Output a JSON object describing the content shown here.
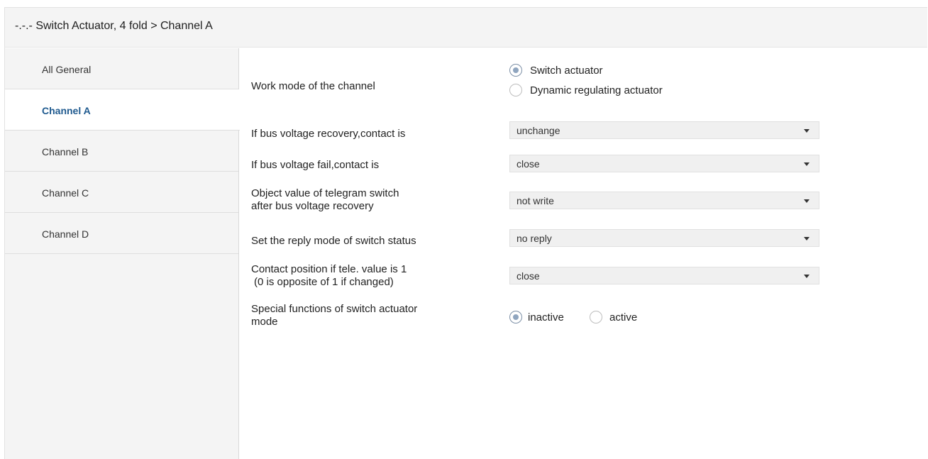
{
  "title": "-.-.- Switch Actuator, 4 fold > Channel A",
  "sidebar": {
    "items": [
      {
        "label": "All General"
      },
      {
        "label": "Channel A"
      },
      {
        "label": "Channel B"
      },
      {
        "label": "Channel C"
      },
      {
        "label": "Channel D"
      }
    ],
    "active": "Channel A"
  },
  "params": {
    "work_mode": {
      "label": "Work mode of the channel",
      "options": [
        "Switch actuator",
        "Dynamic regulating actuator"
      ],
      "selected": "Switch actuator"
    },
    "bus_recovery": {
      "label": "If bus voltage recovery,contact is",
      "value": "unchange"
    },
    "bus_fail": {
      "label": "If bus voltage fail,contact is",
      "value": "close"
    },
    "telegram_switch": {
      "label_line1": "Object value of telegram switch",
      "label_line2": "after bus voltage recovery",
      "value": "not write"
    },
    "reply_mode": {
      "label": "Set the reply mode of switch status",
      "value": "no reply"
    },
    "contact_position": {
      "label_line1": "Contact position if tele. value is 1",
      "label_line2": "(0 is opposite of 1 if changed)",
      "value": "close"
    },
    "special_functions": {
      "label_line1": "Special functions of switch actuator",
      "label_line2": "mode",
      "options": [
        "inactive",
        "active"
      ],
      "selected": "inactive"
    }
  }
}
